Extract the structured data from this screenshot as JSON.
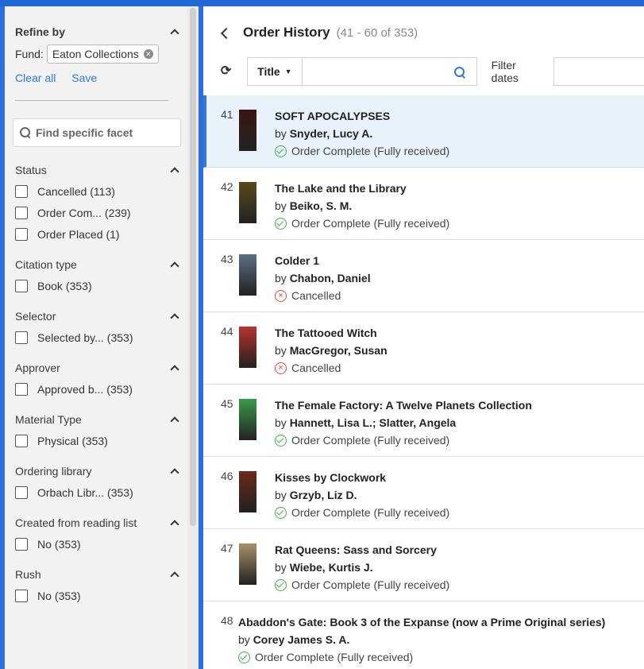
{
  "sidebar": {
    "refine_title": "Refine by",
    "fund_label": "Fund:",
    "fund_chip": "Eaton Collections",
    "clear_all": "Clear all",
    "save": "Save",
    "facet_search_placeholder": "Find specific facet",
    "facets": [
      {
        "title": "Status",
        "items": [
          {
            "label": "Cancelled",
            "count": "(113)"
          },
          {
            "label": "Order Com...",
            "count": "(239)"
          },
          {
            "label": "Order Placed",
            "count": "(1)"
          }
        ]
      },
      {
        "title": "Citation type",
        "items": [
          {
            "label": "Book",
            "count": "(353)"
          }
        ]
      },
      {
        "title": "Selector",
        "items": [
          {
            "label": "Selected by...",
            "count": "(353)"
          }
        ]
      },
      {
        "title": "Approver",
        "items": [
          {
            "label": "Approved b...",
            "count": "(353)"
          }
        ]
      },
      {
        "title": "Material Type",
        "items": [
          {
            "label": "Physical",
            "count": "(353)"
          }
        ]
      },
      {
        "title": "Ordering library",
        "items": [
          {
            "label": "Orbach Libr...",
            "count": "(353)"
          }
        ]
      },
      {
        "title": "Created from reading list",
        "items": [
          {
            "label": "No",
            "count": "(353)"
          }
        ]
      },
      {
        "title": "Rush",
        "items": [
          {
            "label": "No",
            "count": "(353)"
          }
        ]
      }
    ]
  },
  "header": {
    "title": "Order History",
    "range": "(41 - 60 of 353)"
  },
  "toolbar": {
    "field_dropdown": "Title",
    "search_value": "",
    "filter_dates_label": "Filter dates"
  },
  "orders": [
    {
      "num": "41",
      "title": "SOFT APOCALYPSES",
      "by": "by",
      "author": "Snyder, Lucy A.",
      "status": "Order Complete (Fully received)",
      "status_type": "complete",
      "cover_color": "#3a1414"
    },
    {
      "num": "42",
      "title": "The Lake and the Library",
      "by": "by",
      "author": "Beiko, S. M.",
      "status": "Order Complete (Fully received)",
      "status_type": "complete",
      "cover_color": "#5a4a1c"
    },
    {
      "num": "43",
      "title": "Colder 1",
      "by": "by",
      "author": "Chabon, Daniel",
      "status": "Cancelled",
      "status_type": "cancelled",
      "cover_color": "#5d6f86"
    },
    {
      "num": "44",
      "title": "The Tattooed Witch",
      "by": "by",
      "author": "MacGregor, Susan",
      "status": "Cancelled",
      "status_type": "cancelled",
      "cover_color": "#b8322c"
    },
    {
      "num": "45",
      "title": "The Female Factory: A Twelve Planets Collection",
      "by": "by",
      "author": "Hannett, Lisa L.; Slatter, Angela",
      "status": "Order Complete (Fully received)",
      "status_type": "complete",
      "cover_color": "#3a9a4a"
    },
    {
      "num": "46",
      "title": "Kisses by Clockwork",
      "by": "by",
      "author": "Grzyb, Liz D.",
      "status": "Order Complete (Fully received)",
      "status_type": "complete",
      "cover_color": "#6a2a1a"
    },
    {
      "num": "47",
      "title": "Rat Queens: Sass and Sorcery",
      "by": "by",
      "author": "Wiebe, Kurtis J.",
      "status": "Order Complete (Fully received)",
      "status_type": "complete",
      "cover_color": "#a8906a"
    },
    {
      "num": "48",
      "title": "Abaddon's Gate: Book 3 of the Expanse (now a Prime Original series)",
      "by": "by",
      "author": "Corey James S. A.",
      "status": "Order Complete (Fully received)",
      "status_type": "complete",
      "cover_color": ""
    }
  ],
  "colors": {
    "accent": "#2f7bd6",
    "complete": "#3fae49",
    "cancelled": "#e0443f",
    "selected_bg": "#e9f1fb"
  }
}
